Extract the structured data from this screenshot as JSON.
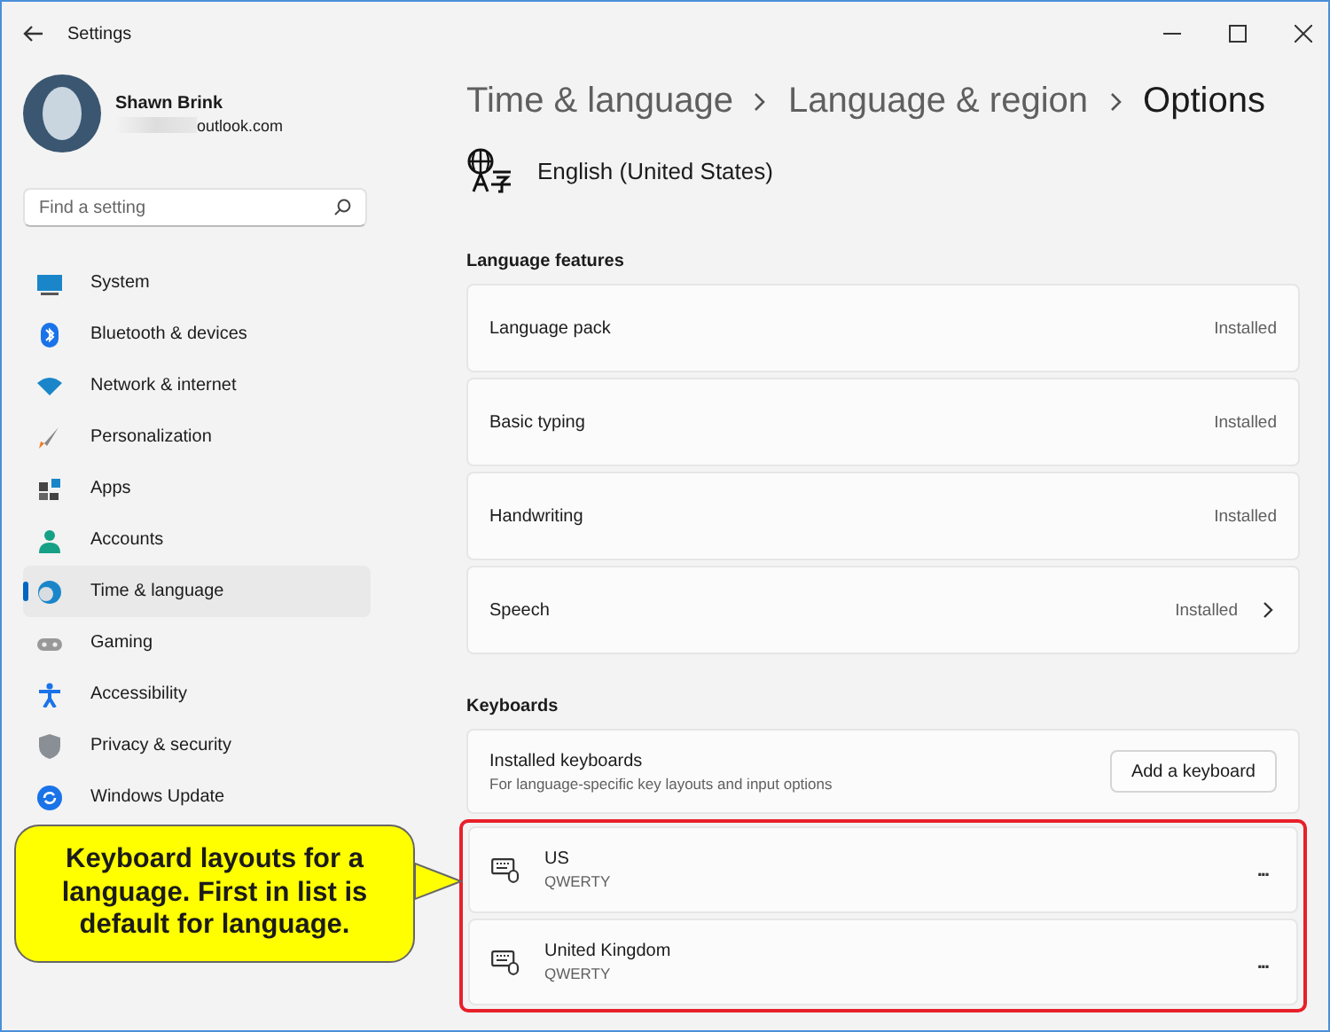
{
  "window": {
    "title": "Settings"
  },
  "account": {
    "name": "Shawn Brink",
    "email": "outlook.com"
  },
  "search": {
    "placeholder": "Find a setting"
  },
  "sidebar": {
    "items": [
      {
        "label": "System",
        "selected": false
      },
      {
        "label": "Bluetooth & devices",
        "selected": false
      },
      {
        "label": "Network & internet",
        "selected": false
      },
      {
        "label": "Personalization",
        "selected": false
      },
      {
        "label": "Apps",
        "selected": false
      },
      {
        "label": "Accounts",
        "selected": false
      },
      {
        "label": "Time & language",
        "selected": true
      },
      {
        "label": "Gaming",
        "selected": false
      },
      {
        "label": "Accessibility",
        "selected": false
      },
      {
        "label": "Privacy & security",
        "selected": false
      },
      {
        "label": "Windows Update",
        "selected": false
      }
    ]
  },
  "breadcrumb": [
    "Time & language",
    "Language & region",
    "Options"
  ],
  "language": "English (United States)",
  "language_features": {
    "heading": "Language features",
    "rows": [
      {
        "label": "Language pack",
        "status": "Installed",
        "chevron": false
      },
      {
        "label": "Basic typing",
        "status": "Installed",
        "chevron": false
      },
      {
        "label": "Handwriting",
        "status": "Installed",
        "chevron": false
      },
      {
        "label": "Speech",
        "status": "Installed",
        "chevron": true
      }
    ]
  },
  "keyboards": {
    "heading": "Keyboards",
    "installed": {
      "title": "Installed keyboards",
      "subtitle": "For language-specific key layouts and input options",
      "button": "Add a keyboard"
    },
    "items": [
      {
        "name": "US",
        "layout": "QWERTY",
        "more": "..."
      },
      {
        "name": "United Kingdom",
        "layout": "QWERTY",
        "more": "..."
      }
    ]
  },
  "callout": "Keyboard layouts for a language. First in list is default for language."
}
